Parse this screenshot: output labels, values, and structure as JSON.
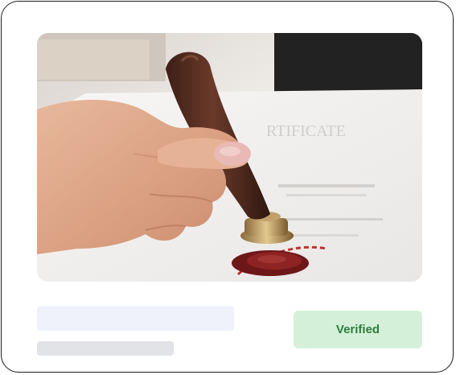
{
  "card": {
    "image": {
      "subject": "hand-pressing-wax-seal-stamp-on-certificate"
    },
    "status_badge": {
      "label": "Verified",
      "background": "#d5f0d8",
      "text_color": "#2f7d3f"
    },
    "placeholders": {
      "line1_color": "#eff2fb",
      "line2_color": "#e1e3e7"
    }
  }
}
